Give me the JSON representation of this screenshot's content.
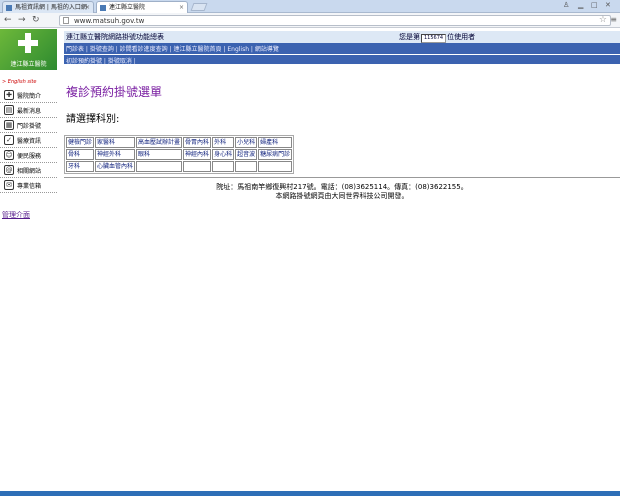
{
  "browser": {
    "tabs": [
      {
        "label": "馬祖資訊網 | 馬祖的入口網"
      },
      {
        "label": "連江縣立醫院"
      }
    ],
    "url": "www.matsuh.gov.tw"
  },
  "logo": {
    "name": "連江縣立醫院"
  },
  "english_site": "> English site",
  "sidebar": {
    "items": [
      {
        "icon": "hospital-icon",
        "label": "醫院簡介"
      },
      {
        "icon": "news-icon",
        "label": "最新消息"
      },
      {
        "icon": "clinic-icon",
        "label": "門診掛號"
      },
      {
        "icon": "health-icon",
        "label": "醫療資訊"
      },
      {
        "icon": "service-icon",
        "label": "便民服務"
      },
      {
        "icon": "link-icon",
        "label": "相關網站"
      },
      {
        "icon": "mail-icon",
        "label": "專業信箱"
      }
    ],
    "admin_link": "管理介面"
  },
  "header": {
    "title": "連江縣立醫院網路掛號功能總表",
    "visitor_prefix": "您是第",
    "visitor_count": "115674",
    "visitor_suffix": "位使用者",
    "nav1": "門診表 | 掛號查詢 | 診間看診進度查詢 | 連江縣立醫院首頁 | English | 網站導覽",
    "nav2": "初診預約掛號 | 掛號取消 |"
  },
  "main": {
    "heading": "複診預約掛號選單",
    "subheading": "請選擇科別:",
    "departments": [
      [
        "健檢門診",
        "家醫科",
        "高血壓試辦計畫",
        "骨胃內科",
        "外科",
        "小兒科",
        "婦產科"
      ],
      [
        "骨科",
        "神經外科",
        "眼科",
        "神經內科",
        "身心科",
        "超音波",
        "糖尿病門診"
      ],
      [
        "牙科",
        "心臟血管內科",
        "",
        "",
        "",
        "",
        ""
      ]
    ]
  },
  "footer": {
    "line1": "院址：馬祖南竿鄉復興村217號。電話：(08)3625114。傳真：(08)3622155。",
    "line2": "本網路掛號網頁由大同世界科技公司開發。"
  }
}
